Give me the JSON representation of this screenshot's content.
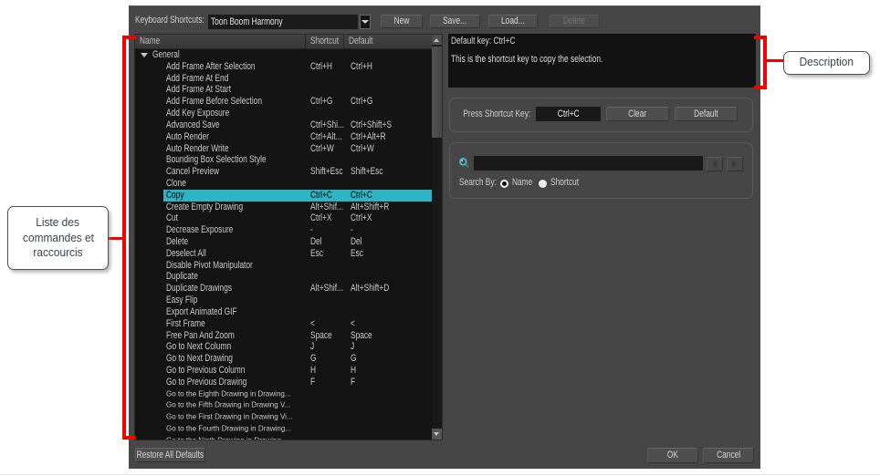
{
  "toolbar": {
    "label": "Keyboard Shortcuts:",
    "preset_value": "Toon Boom Harmony",
    "buttons": [
      {
        "label": "New",
        "enabled": true
      },
      {
        "label": "Save...",
        "enabled": true
      },
      {
        "label": "Load...",
        "enabled": true
      },
      {
        "label": "Delete",
        "enabled": false
      }
    ]
  },
  "shortcut_list": {
    "columns": [
      "Name",
      "Shortcut",
      "Default"
    ],
    "rows": [
      {
        "name": "General",
        "shortcut": "",
        "default": "",
        "group": true
      },
      {
        "name": "Add Frame After Selection",
        "shortcut": "Ctrl+H",
        "default": "Ctrl+H"
      },
      {
        "name": "Add Frame At End",
        "shortcut": "",
        "default": ""
      },
      {
        "name": "Add Frame At Start",
        "shortcut": "",
        "default": ""
      },
      {
        "name": "Add Frame Before Selection",
        "shortcut": "Ctrl+G",
        "default": "Ctrl+G"
      },
      {
        "name": "Add Key Exposure",
        "shortcut": "",
        "default": ""
      },
      {
        "name": "Advanced Save",
        "shortcut": "Ctrl+Shi...",
        "default": "Ctrl+Shift+S"
      },
      {
        "name": "Auto Render",
        "shortcut": "Ctrl+Alt...",
        "default": "Ctrl+Alt+R"
      },
      {
        "name": "Auto Render Write",
        "shortcut": "Ctrl+W",
        "default": "Ctrl+W"
      },
      {
        "name": "Bounding Box Selection Style",
        "shortcut": "",
        "default": ""
      },
      {
        "name": "Cancel Preview",
        "shortcut": "Shift+Esc",
        "default": "Shift+Esc"
      },
      {
        "name": "Clone",
        "shortcut": "",
        "default": ""
      },
      {
        "name": "Copy",
        "shortcut": "Ctrl+C",
        "default": "Ctrl+C",
        "selected": true
      },
      {
        "name": "Create Empty Drawing",
        "shortcut": "Alt+Shif...",
        "default": "Alt+Shift+R"
      },
      {
        "name": "Cut",
        "shortcut": "Ctrl+X",
        "default": "Ctrl+X"
      },
      {
        "name": "Decrease Exposure",
        "shortcut": "-",
        "default": "-"
      },
      {
        "name": "Delete",
        "shortcut": "Del",
        "default": "Del"
      },
      {
        "name": "Deselect All",
        "shortcut": "Esc",
        "default": "Esc"
      },
      {
        "name": "Disable Pivot Manipulator",
        "shortcut": "",
        "default": ""
      },
      {
        "name": "Duplicate",
        "shortcut": "",
        "default": ""
      },
      {
        "name": "Duplicate Drawings",
        "shortcut": "Alt+Shif...",
        "default": "Alt+Shift+D"
      },
      {
        "name": "Easy Flip",
        "shortcut": "",
        "default": ""
      },
      {
        "name": "Export Animated GIF",
        "shortcut": "",
        "default": ""
      },
      {
        "name": "First Frame",
        "shortcut": "<",
        "default": "<"
      },
      {
        "name": "Free Pan And Zoom",
        "shortcut": "Space",
        "default": "Space"
      },
      {
        "name": "Go to Next Column",
        "shortcut": "J",
        "default": "J"
      },
      {
        "name": "Go to Next Drawing",
        "shortcut": "G",
        "default": "G"
      },
      {
        "name": "Go to Previous Column",
        "shortcut": "H",
        "default": "H"
      },
      {
        "name": "Go to Previous Drawing",
        "shortcut": "F",
        "default": "F"
      },
      {
        "name": "Go to the Eighth Drawing in Drawing...",
        "shortcut": "",
        "default": "",
        "small": true
      },
      {
        "name": "Go to the Fifth Drawing in Drawing V...",
        "shortcut": "",
        "default": "",
        "small": true
      },
      {
        "name": "Go to the First Drawing in Drawing Vi...",
        "shortcut": "",
        "default": "",
        "small": true
      },
      {
        "name": "Go to the Fourth Drawing in Drawing...",
        "shortcut": "",
        "default": "",
        "small": true
      },
      {
        "name": "Go to the Ninth Drawing in Drawing...",
        "shortcut": "",
        "default": "",
        "small": true
      }
    ]
  },
  "description_panel": {
    "line1": "Default key: Ctrl+C",
    "line2": "This is the shortcut key to copy the selection."
  },
  "press_shortcut": {
    "label": "Press Shortcut Key:",
    "key_value": "Ctrl+C",
    "clear_label": "Clear",
    "default_label": "Default"
  },
  "search": {
    "input_value": "",
    "search_by_label": "Search By:",
    "options": [
      {
        "label": "Name",
        "selected": true
      },
      {
        "label": "Shortcut",
        "selected": false
      }
    ]
  },
  "footer": {
    "restore_label": "Restore All Defaults",
    "ok_label": "OK",
    "cancel_label": "Cancel"
  },
  "annotations": {
    "left_callout": "Liste des commandes et raccourcis",
    "left_callout_lines": [
      "Liste des",
      "commandes et",
      "raccourcis"
    ],
    "right_callout": "Description"
  },
  "colors": {
    "accent_red": "#f40000",
    "selection_cyan": "#2db4c5",
    "dialog_gray": "#464646",
    "list_black": "#141414"
  }
}
